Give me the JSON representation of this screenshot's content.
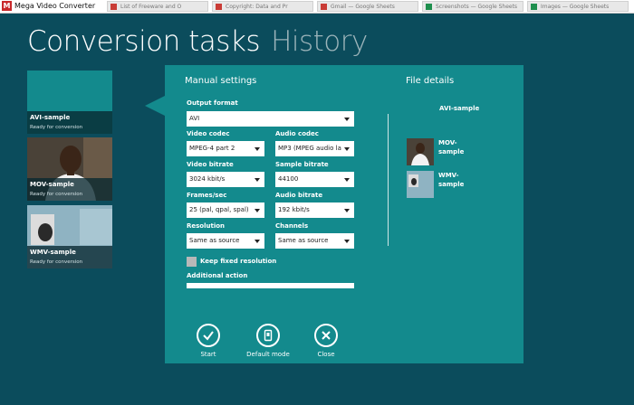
{
  "window": {
    "title": "Mega Video Converter",
    "logo_letter": "M"
  },
  "browser_tabs": [
    {
      "label": "List of Freeware and O"
    },
    {
      "label": "Copyright: Data and Pr"
    },
    {
      "label": "Gmail — Google Sheets"
    },
    {
      "label": "Screenshots — Google Sheets"
    },
    {
      "label": "Images — Google Sheets"
    }
  ],
  "header": {
    "current": "Conversion tasks",
    "other": "History"
  },
  "tasks": [
    {
      "name": "AVI-sample",
      "status": "Ready for conversion"
    },
    {
      "name": "MOV-sample",
      "status": "Ready for conversion"
    },
    {
      "name": "WMV-sample",
      "status": "Ready for conversion"
    }
  ],
  "manual": {
    "title": "Manual settings",
    "output_format": {
      "label": "Output format",
      "value": "AVI"
    },
    "video_codec": {
      "label": "Video codec",
      "value": "MPEG-4 part 2"
    },
    "audio_codec": {
      "label": "Audio codec",
      "value": "MP3 (MPEG audio lay"
    },
    "video_bitrate": {
      "label": "Video bitrate",
      "value": "3024 kbit/s"
    },
    "sample_bitrate": {
      "label": "Sample bitrate",
      "value": "44100"
    },
    "frames": {
      "label": "Frames/sec",
      "value": "25 (pal, qpal, spal)"
    },
    "audio_bitrate": {
      "label": "Audio bitrate",
      "value": "192 kbit/s"
    },
    "resolution": {
      "label": "Resolution",
      "value": "Same as source"
    },
    "channels": {
      "label": "Channels",
      "value": "Same as source"
    },
    "keep_fixed": {
      "label": "Keep fixed resolution",
      "checked": false
    },
    "additional": {
      "label": "Additional action",
      "value": ""
    }
  },
  "file_details": {
    "title": "File details",
    "current": "AVI-sample",
    "files": [
      {
        "line1": "MOV-",
        "line2": "sample"
      },
      {
        "line1": "WMV-",
        "line2": "sample"
      }
    ]
  },
  "actions": {
    "start": {
      "label": "Start",
      "icon": "check-icon"
    },
    "default_mode": {
      "label": "Default mode",
      "icon": "device-icon"
    },
    "close": {
      "label": "Close",
      "icon": "close-icon"
    }
  },
  "colors": {
    "background": "#0b4c5c",
    "panel": "#138a8d",
    "selected_task": "#138a8d"
  }
}
